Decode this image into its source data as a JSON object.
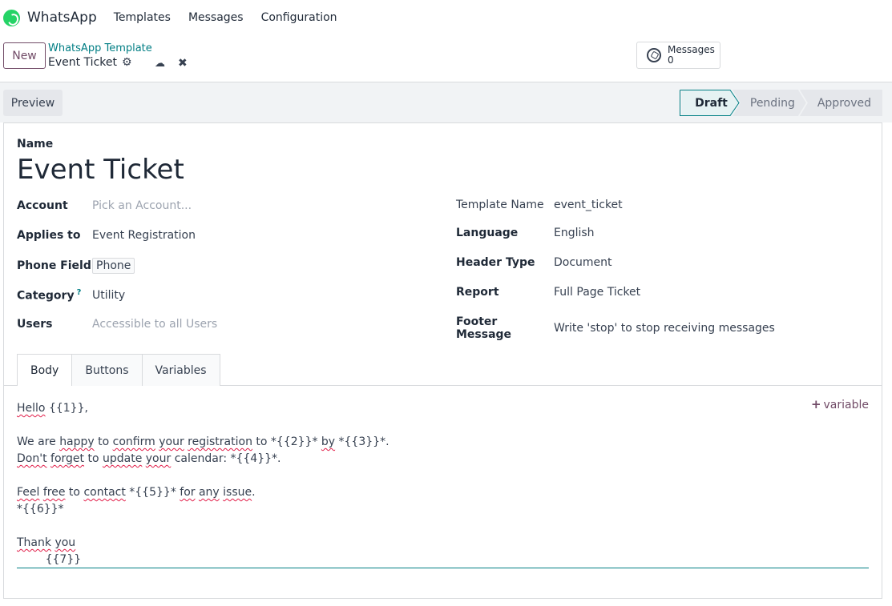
{
  "nav": {
    "app_name": "WhatsApp",
    "items": [
      "Templates",
      "Messages",
      "Configuration"
    ]
  },
  "control": {
    "new_label": "New",
    "breadcrumb": "WhatsApp Template",
    "record": "Event Ticket",
    "smart_button": {
      "label": "Messages",
      "count": "0"
    }
  },
  "status": {
    "preview_label": "Preview",
    "stages": [
      "Draft",
      "Pending",
      "Approved"
    ],
    "active_stage": "Draft"
  },
  "form": {
    "name_label": "Name",
    "name_value": "Event Ticket",
    "left_fields": [
      {
        "label": "Account",
        "value": "Pick an Account...",
        "placeholder": true
      },
      {
        "label": "Applies to",
        "value": "Event Registration"
      },
      {
        "label": "Phone Field",
        "value": "Phone"
      },
      {
        "label": "Category",
        "help": "?",
        "value": "Utility"
      },
      {
        "label": "Users",
        "value": "Accessible to all Users",
        "placeholder": true
      }
    ],
    "right_fields": [
      {
        "label": "Template Name",
        "value": "event_ticket"
      },
      {
        "label": "Language",
        "value": "English"
      },
      {
        "label": "Header Type",
        "value": "Document"
      },
      {
        "label": "Report",
        "value": "Full Page Ticket"
      },
      {
        "label": "Footer Message",
        "value": "Write 'stop' to stop receiving messages"
      }
    ],
    "tabs": [
      "Body",
      "Buttons",
      "Variables"
    ],
    "add_variable": "variable",
    "body_lines": [
      "Hello {{1}},",
      "",
      "We are happy to confirm your registration to *{{2}}* by *{{3}}*.",
      "Don't forget to update your calendar: *{{4}}*.",
      "",
      "Feel free to contact *{{5}}* for any issue.",
      "*{{6}}*",
      "",
      "Thank you",
      "        {{7}}"
    ]
  }
}
